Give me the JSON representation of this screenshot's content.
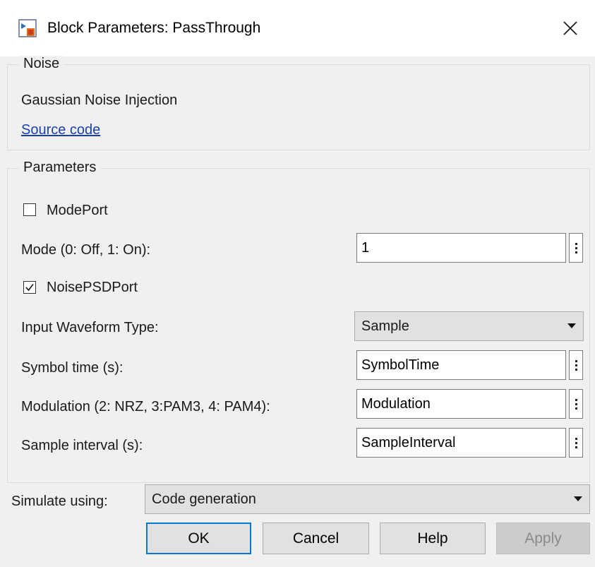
{
  "window": {
    "title": "Block Parameters: PassThrough",
    "icon": "simulink-block-icon",
    "close_icon": "close-icon"
  },
  "noise": {
    "title": "Noise",
    "description": "Gaussian Noise Injection",
    "link": "Source code"
  },
  "parameters": {
    "title": "Parameters",
    "mode_port": {
      "label": "ModePort",
      "checked": false
    },
    "mode": {
      "label": "Mode (0: Off, 1: On):",
      "value": "1"
    },
    "noise_psd_port": {
      "label": "NoisePSDPort",
      "checked": true
    },
    "input_waveform": {
      "label": "Input Waveform Type:",
      "value": "Sample"
    },
    "symbol_time": {
      "label": "Symbol time (s):",
      "value": "SymbolTime"
    },
    "modulation": {
      "label": "Modulation (2: NRZ, 3:PAM3, 4: PAM4):",
      "value": "Modulation"
    },
    "sample_interval": {
      "label": "Sample interval (s):",
      "value": "SampleInterval"
    }
  },
  "simulate": {
    "label": "Simulate using:",
    "value": "Code generation"
  },
  "buttons": {
    "ok": "OK",
    "cancel": "Cancel",
    "help": "Help",
    "apply": "Apply"
  },
  "colors": {
    "accent": "#0078d7",
    "link": "#1a3fb0",
    "background": "#f0f0f0"
  }
}
